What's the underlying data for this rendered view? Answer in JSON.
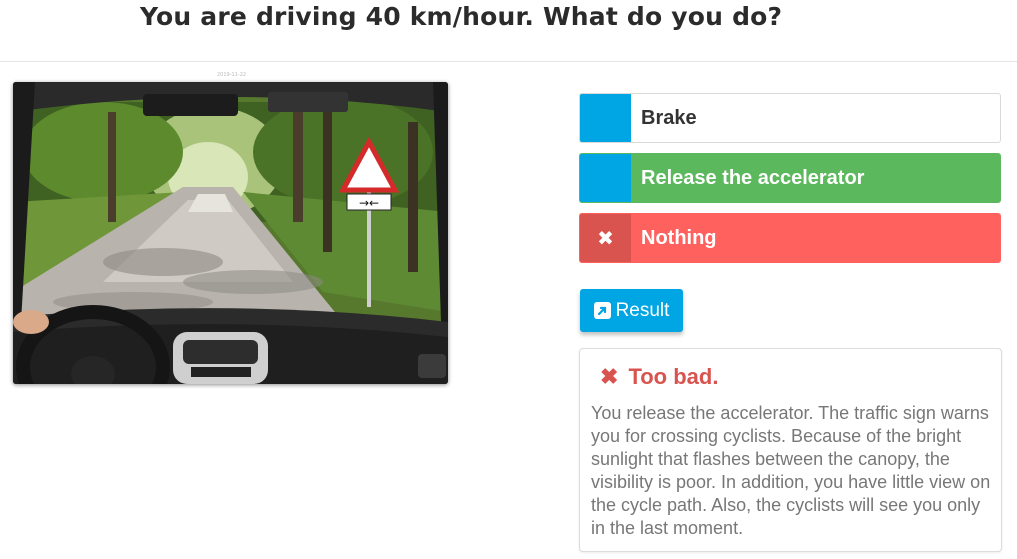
{
  "question": {
    "title": "You are driving 40 km/hour. What do you do?"
  },
  "photo": {
    "description_icon": "dashboard-road-photo",
    "caption": "2019-11-22"
  },
  "answers": [
    {
      "label": "Brake",
      "marker": "",
      "state": "neutral"
    },
    {
      "label": "Release the accelerator",
      "marker": "",
      "state": "correct"
    },
    {
      "label": "Nothing",
      "marker": "✖",
      "state": "wrong"
    }
  ],
  "result_button": {
    "label": "Result",
    "icon": "external-link-icon"
  },
  "feedback": {
    "icon": "times-icon",
    "title": "Too bad.",
    "text": "You release the accelerator. The traffic sign warns you for crossing cyclists. Because of the bright sunlight that flashes between the canopy, the visibility is poor. In addition, you have little view on the cycle path. Also, the cyclists will see you only in the last moment."
  },
  "colors": {
    "accent": "#00a5e3",
    "correct": "#5cb85c",
    "wrong": "#ff625e",
    "wrong_marker": "#d9534f",
    "feedback_title": "#d9534f"
  }
}
